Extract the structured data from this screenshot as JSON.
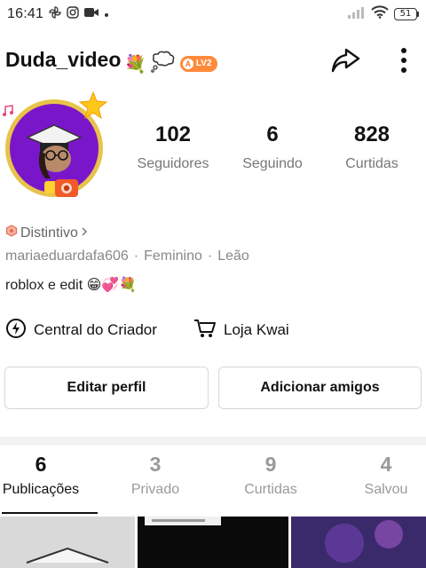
{
  "status_bar": {
    "time": "16:41",
    "battery": "51",
    "icons": [
      "pinwheel-icon",
      "instagram-icon",
      "video-camera-icon",
      "dot-icon",
      "signal-icon",
      "wifi-icon",
      "battery-icon"
    ]
  },
  "profile": {
    "username": "Duda_video",
    "level_badge": "LV2",
    "stats": [
      {
        "value": "102",
        "label": "Seguidores"
      },
      {
        "value": "6",
        "label": "Seguindo"
      },
      {
        "value": "828",
        "label": "Curtidas"
      }
    ],
    "badge_label": "Distintivo",
    "handle": "mariaeduardafa606",
    "gender": "Feminino",
    "sign": "Leão",
    "separator": "·",
    "bio": "roblox e edit 😁💞💐"
  },
  "links": {
    "creator_center": "Central do Criador",
    "store": "Loja Kwai"
  },
  "actions": {
    "edit_profile": "Editar perfil",
    "add_friends": "Adicionar amigos"
  },
  "tabs": [
    {
      "count": "6",
      "label": "Publicações",
      "active": true
    },
    {
      "count": "3",
      "label": "Privado",
      "active": false
    },
    {
      "count": "9",
      "label": "Curtidas",
      "active": false
    },
    {
      "count": "4",
      "label": "Salvou",
      "active": false
    }
  ],
  "colors": {
    "avatar_bg": "#7a16c9",
    "avatar_ring": "#e8c34a",
    "level_badge": "#ff8a3c",
    "text_primary": "#111111",
    "text_muted": "#888888"
  }
}
